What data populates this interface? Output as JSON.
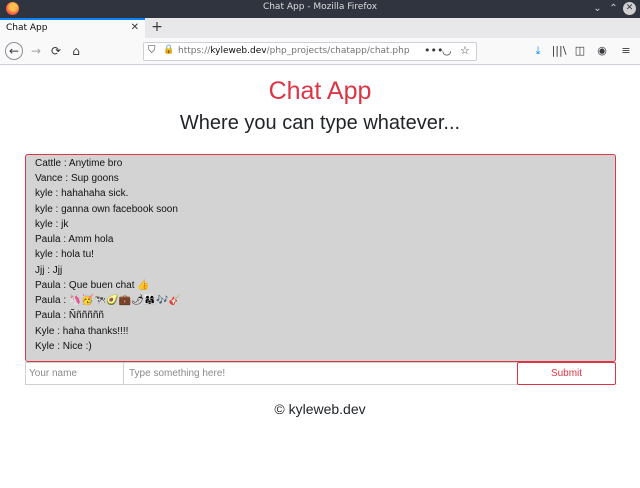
{
  "window": {
    "title": "Chat App - Mozilla Firefox",
    "minimize_glyph": "⌄",
    "maximize_glyph": "⌃",
    "close_glyph": "✕"
  },
  "tabs": [
    {
      "label": "Chat App",
      "close_glyph": "✕"
    }
  ],
  "newtab_glyph": "+",
  "navbar": {
    "back_glyph": "←",
    "forward_glyph": "→",
    "reload_glyph": "⟳",
    "home_glyph": "⌂",
    "url_prefix": "https://",
    "url_domain": "kyleweb.dev",
    "url_path": "/php_projects/chatapp/chat.php",
    "shield_glyph": "⛉",
    "lock_glyph": "🔒",
    "more_glyph": "•••",
    "pocket_glyph": "◡",
    "star_glyph": "☆",
    "download_glyph": "⤓",
    "library_glyph": "|||\\",
    "sidebar_glyph": "◫",
    "account_glyph": "◉",
    "menu_glyph": "≡"
  },
  "page": {
    "title": "Chat App",
    "subtitle": "Where you can type whatever...",
    "messages": [
      {
        "text": "Cattle : Anytime bro"
      },
      {
        "text": "Vance : Sup goons"
      },
      {
        "text": "kyle : hahahaha sick."
      },
      {
        "text": "kyle : ganna own facebook soon"
      },
      {
        "text": "kyle : jk"
      },
      {
        "text": "Paula : Amm hola"
      },
      {
        "text": "kyle : hola tu!"
      },
      {
        "text": "Jjj : Jjj"
      },
      {
        "text": "Paula : Que buen chat 👍"
      },
      {
        "text": "Paula : 🦄🥳🐄🥑💼🌶👩‍👩‍👧🎶🎸"
      },
      {
        "text": "Paula : Ññññññ"
      },
      {
        "text": "Kyle : haha thanks!!!!"
      },
      {
        "text": "Kyle : Nice :)"
      }
    ],
    "name_placeholder": "Your name",
    "message_placeholder": "Type something here!",
    "submit_label": "Submit",
    "footer": "© kyleweb.dev"
  },
  "colors": {
    "accent": "#dc3545",
    "chat_background": "#d3d3d3",
    "titlebar": "#2f343f",
    "firefox_blue": "#0a84ff"
  }
}
